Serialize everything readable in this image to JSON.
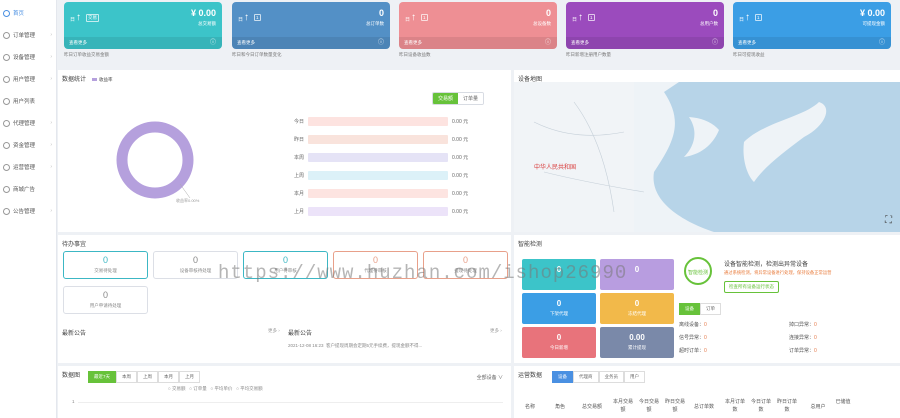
{
  "sidebar": {
    "items": [
      {
        "label": "首页",
        "arrow": ""
      },
      {
        "label": "订单管理",
        "arrow": "›"
      },
      {
        "label": "设备管理",
        "arrow": "›"
      },
      {
        "label": "用户管理",
        "arrow": "›"
      },
      {
        "label": "用户列表",
        "arrow": ""
      },
      {
        "label": "代理管理",
        "arrow": "›"
      },
      {
        "label": "资金管理",
        "arrow": "›"
      },
      {
        "label": "运营管理",
        "arrow": "›"
      },
      {
        "label": "商城广告",
        "arrow": ""
      },
      {
        "label": "公告管理",
        "arrow": "›"
      }
    ]
  },
  "cards": [
    {
      "period": "日",
      "badge": "交易",
      "value": "¥ 0.00",
      "sub": "总交易额",
      "foot": "查看更多",
      "caption": "昨日订单收益交易金额",
      "color": "#3cc4c9"
    },
    {
      "period": "日",
      "badge": "1",
      "value": "0",
      "sub": "总订单数",
      "foot": "查看更多",
      "caption": "昨日和今日订单数量变化",
      "color": "#5390c6"
    },
    {
      "period": "日",
      "badge": "1",
      "value": "0",
      "sub": "总设备数",
      "foot": "查看更多",
      "caption": "昨日设备收益数",
      "color": "#ee8f94"
    },
    {
      "period": "日",
      "badge": "1",
      "value": "0",
      "sub": "总用户数",
      "foot": "查看更多",
      "caption": "昨日新增注册用户数量",
      "color": "#9b4bbd"
    },
    {
      "period": "日",
      "badge": "1",
      "value": "¥ 0.00",
      "sub": "可提现金额",
      "foot": "查看更多",
      "caption": "昨日可提现收益",
      "color": "#3b9ee5"
    }
  ],
  "data_stats": {
    "title": "数据统计",
    "legend": "收益率",
    "tabs": [
      "交易额",
      "订单量"
    ],
    "donut_label": "收益率0.00%",
    "rows": [
      {
        "label": "今日",
        "value": "0.00 元",
        "color": "#fde3e0"
      },
      {
        "label": "昨日",
        "value": "0.00 元",
        "color": "#f9e3dc"
      },
      {
        "label": "本周",
        "value": "0.00 元",
        "color": "#e5e3f6"
      },
      {
        "label": "上周",
        "value": "0.00 元",
        "color": "#dcf1f8"
      },
      {
        "label": "本月",
        "value": "0.00 元",
        "color": "#fde4e1"
      },
      {
        "label": "上月",
        "value": "0.00 元",
        "color": "#ece3f9"
      }
    ]
  },
  "device_map": {
    "title": "设备地图",
    "region_label": "中华人民共和国"
  },
  "todo": {
    "title": "待办事宜",
    "items": [
      {
        "num": "0",
        "text": "交易待处理",
        "color": "#3cb7c4"
      },
      {
        "num": "0",
        "text": "设备审核待处理",
        "color": "#888"
      },
      {
        "num": "0",
        "text": "用户待审核",
        "color": "#3cb7c4"
      },
      {
        "num": "0",
        "text": "代理待审核",
        "color": "#e8a08a"
      },
      {
        "num": "0",
        "text": "提现待处理",
        "color": "#e8a08a"
      },
      {
        "num": "0",
        "text": "用户申请待处理",
        "color": "#888"
      }
    ]
  },
  "notices": {
    "left_title": "最新公告",
    "more": "更多 ›",
    "right_title": "最新公告",
    "date": "2021-12-08 16:23",
    "text": "客户提现周期会定期5元手续费，提现金额不得..."
  },
  "smart": {
    "title": "智能检测",
    "tiles": [
      {
        "num": "0",
        "text": "",
        "color": "#3cc4c9"
      },
      {
        "num": "0",
        "text": "",
        "color": "#b89de0"
      },
      {
        "num": "0",
        "text": "下架代理",
        "color": "#3b9ee5"
      },
      {
        "num": "0",
        "text": "冻结代理",
        "color": "#f2b94a"
      },
      {
        "num": "0",
        "text": "今日新增",
        "color": "#e8737b"
      },
      {
        "num": "0.00",
        "text": "累计提现",
        "color": "#7a89a9"
      }
    ],
    "circle": "智能检测",
    "headline": "设备智能检测，检测出异常设备",
    "desc": "通过系统检测，将异常设备进行处理，保持设备正常运营",
    "btn": "检查所有设备运行状态",
    "tabs": [
      "设备",
      "订单"
    ],
    "stats": [
      {
        "label": "离线设备：",
        "value": "0"
      },
      {
        "label": "掉口异常：",
        "value": "0"
      },
      {
        "label": "信号异常：",
        "value": "0"
      },
      {
        "label": "连接异常：",
        "value": "0"
      },
      {
        "label": "超时订单：",
        "value": "0"
      },
      {
        "label": "订单异常：",
        "value": "0"
      }
    ]
  },
  "data_chart": {
    "title": "数据图",
    "tabs": [
      "最近7天",
      "本周",
      "上周",
      "本月",
      "上月"
    ],
    "dropdown": "全部设备 ∨",
    "legend": [
      "交易额",
      "订单量",
      "平均单价",
      "平均交易额"
    ],
    "y_tick": "1"
  },
  "ranking": {
    "title": "运营数据",
    "tabs": [
      "设备",
      "代理商",
      "业务员",
      "用户"
    ],
    "columns": [
      "名称",
      "角色",
      "总交易额",
      "本月交易额",
      "今日交易额",
      "昨日交易额",
      "总订单数",
      "本月订单数",
      "今日订单数",
      "昨日订单数",
      "总用户",
      "已储值"
    ]
  },
  "watermark": "https://www.huzhan.com/ishop26990"
}
